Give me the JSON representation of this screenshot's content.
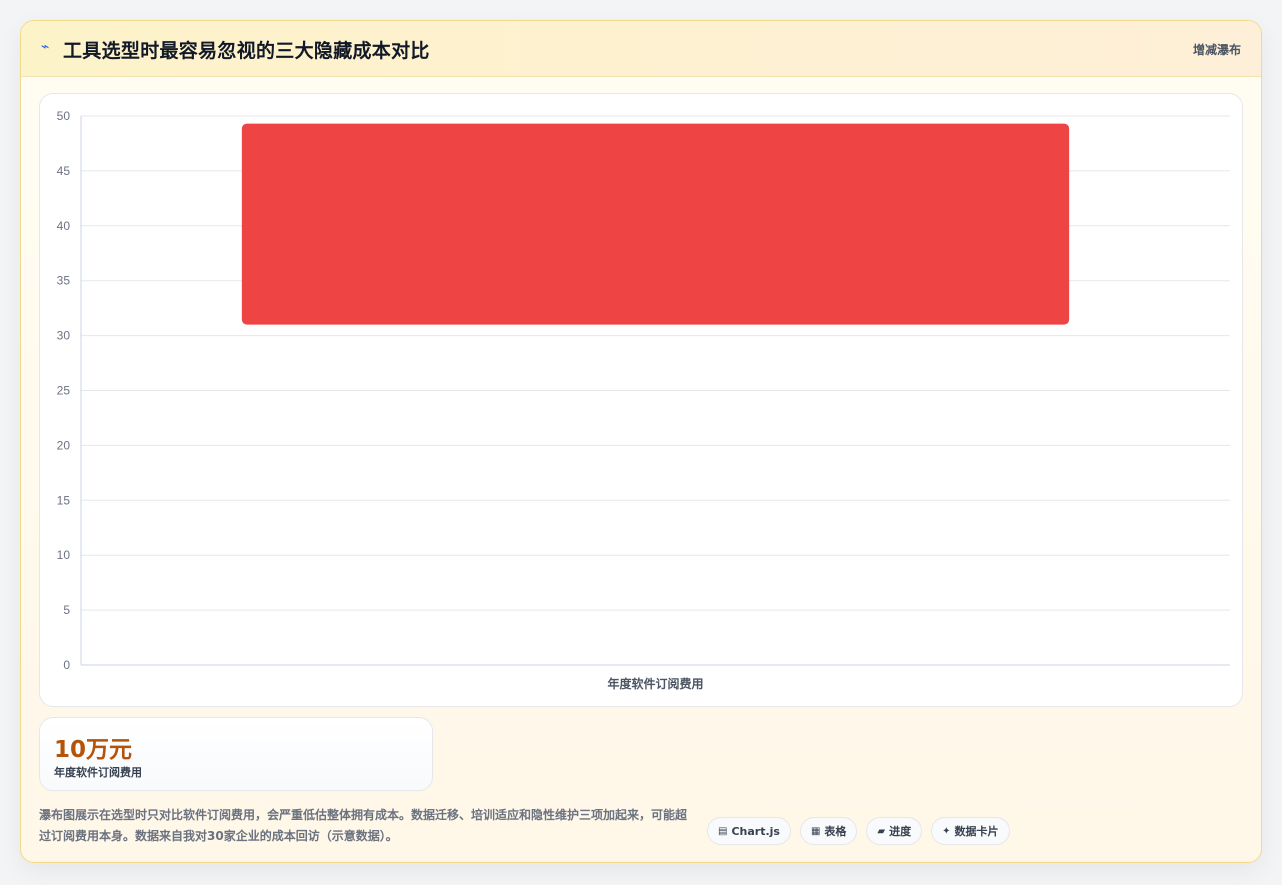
{
  "header": {
    "icon": "⌁",
    "title": "工具选型时最容易忽视的三大隐藏成本对比",
    "link": "增减瀑布"
  },
  "chart_data": {
    "type": "bar",
    "subtype": "waterfall",
    "categories": [
      "年度软件订阅费用"
    ],
    "ranges": [
      [
        31,
        49.3
      ]
    ],
    "ylim": [
      0,
      50
    ],
    "yticks": [
      0,
      5,
      10,
      15,
      20,
      25,
      30,
      35,
      40,
      45,
      50
    ],
    "grid": true,
    "color": "#ef4444"
  },
  "stat": {
    "value": "10万元",
    "label": "年度软件订阅费用"
  },
  "description": "瀑布图展示在选型时只对比软件订阅费用，会严重低估整体拥有成本。数据迁移、培训适应和隐性维护三项加起来，可能超过订阅费用本身。数据来自我对30家企业的成本回访（示意数据）。",
  "chips": [
    {
      "icon": "▤",
      "label": "Chart.js"
    },
    {
      "icon": "▦",
      "label": "表格"
    },
    {
      "icon": "▰",
      "label": "进度"
    },
    {
      "icon": "✦",
      "label": "数据卡片"
    }
  ]
}
